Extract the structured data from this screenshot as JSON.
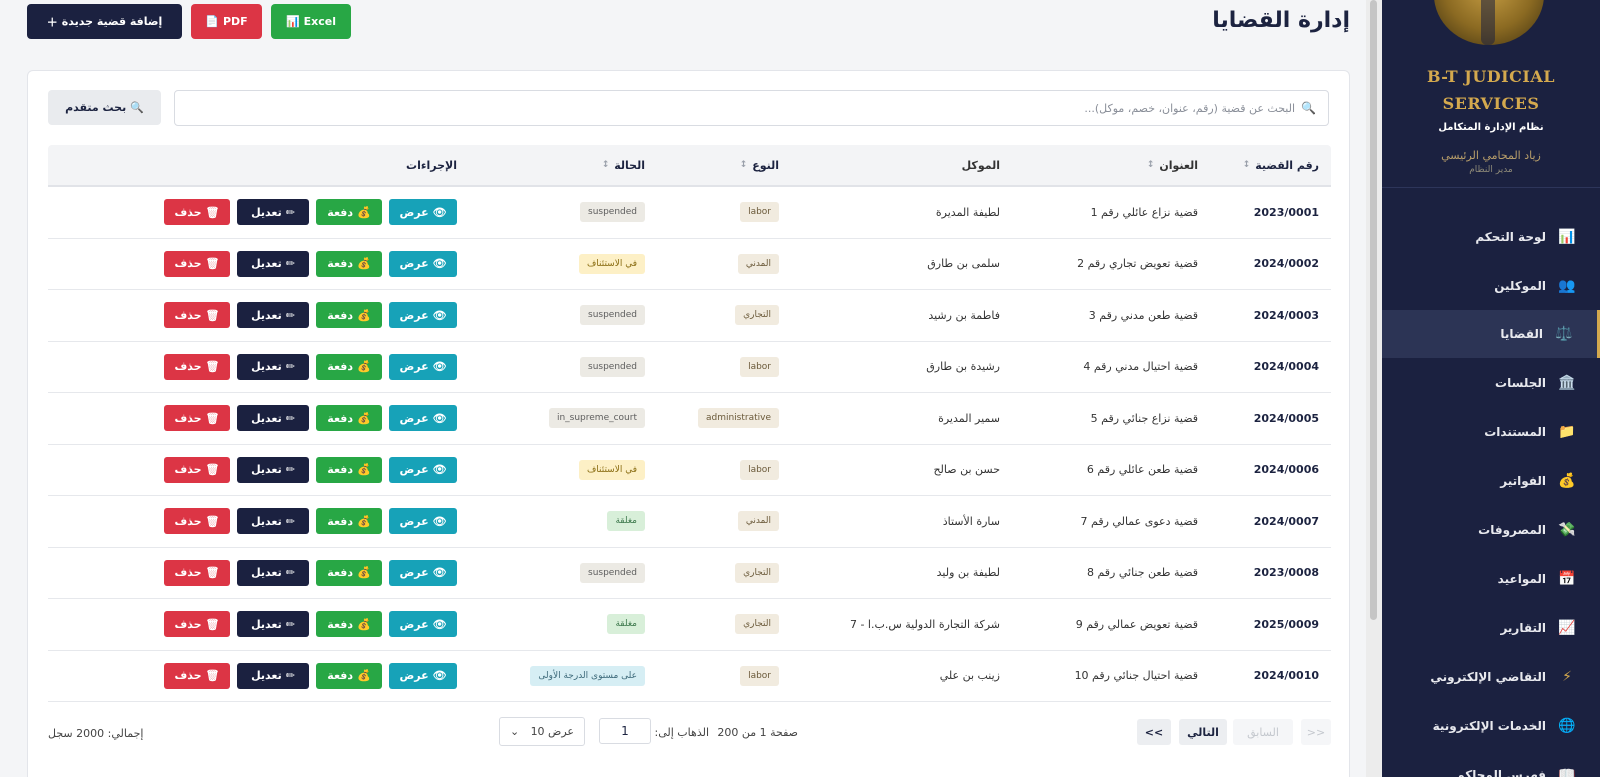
{
  "header": {
    "title": "إدارة القضايا",
    "buttons": {
      "new_case": "إضافة قضية جديدة",
      "pdf": "PDF",
      "excel": "Excel"
    }
  },
  "sidebar": {
    "brand_line1": "B-T JUDICIAL",
    "brand_line2": "SERVICES",
    "subtitle": "نظام الإدارة المتكامل",
    "user_name": "زياد المحامي الرئيسي",
    "user_role": "مدير النظام",
    "items": [
      {
        "label": "لوحة التحكم",
        "icon": "📊"
      },
      {
        "label": "الموكلين",
        "icon": "👥"
      },
      {
        "label": "القضايا",
        "icon": "⚖️",
        "active": true
      },
      {
        "label": "الجلسات",
        "icon": "🏛️"
      },
      {
        "label": "المستندات",
        "icon": "📁"
      },
      {
        "label": "الفواتير",
        "icon": "💰"
      },
      {
        "label": "المصروفات",
        "icon": "💸"
      },
      {
        "label": "المواعيد",
        "icon": "📅"
      },
      {
        "label": "التقارير",
        "icon": "📈"
      },
      {
        "label": "التقاضي الإلكتروني",
        "icon": "⚡"
      },
      {
        "label": "الخدمات الإلكترونية",
        "icon": "🌐"
      },
      {
        "label": "فهرس المحاكم",
        "icon": "📖"
      }
    ]
  },
  "search": {
    "placeholder": "البحث عن قضية (رقم، عنوان، خصم، موكل)...",
    "advanced_label": "بحث متقدم"
  },
  "table": {
    "columns": {
      "number": "رقم القضية",
      "title": "العنوان",
      "client": "الموكل",
      "type": "النوع",
      "status": "الحالة",
      "actions": "الإجراءات"
    },
    "action_labels": {
      "view": "عرض",
      "pay": "دفعة",
      "edit": "تعديل",
      "delete": "حذف"
    },
    "rows": [
      {
        "number": "2023/0001",
        "title": "قضية نزاع عائلي رقم 1",
        "client": "لطيفة المديرة",
        "type": "labor",
        "status": "suspended",
        "status_style": "gray"
      },
      {
        "number": "2024/0002",
        "title": "قضية تعويض تجاري رقم 2",
        "client": "سلمى بن طارق",
        "type": "المدني",
        "status": "في الاستئناف",
        "status_style": "yellow"
      },
      {
        "number": "2024/0003",
        "title": "قضية طعن مدني رقم 3",
        "client": "فاطمة بن رشيد",
        "type": "التجاري",
        "status": "suspended",
        "status_style": "gray"
      },
      {
        "number": "2024/0004",
        "title": "قضية احتيال مدني رقم 4",
        "client": "رشيدة بن طارق",
        "type": "labor",
        "status": "suspended",
        "status_style": "gray"
      },
      {
        "number": "2024/0005",
        "title": "قضية نزاع جنائي رقم 5",
        "client": "سمير المديرة",
        "type": "administrative",
        "status": "in_supreme_court",
        "status_style": "gray"
      },
      {
        "number": "2024/0006",
        "title": "قضية طعن عائلي رقم 6",
        "client": "حسن بن صالح",
        "type": "labor",
        "status": "في الاستئناف",
        "status_style": "yellow"
      },
      {
        "number": "2024/0007",
        "title": "قضية دعوى عمالي رقم 7",
        "client": "سارة الأستاذ",
        "type": "المدني",
        "status": "مغلقة",
        "status_style": "green"
      },
      {
        "number": "2023/0008",
        "title": "قضية طعن جنائي رقم 8",
        "client": "لطيفة بن وليد",
        "type": "التجاري",
        "status": "suspended",
        "status_style": "gray"
      },
      {
        "number": "2025/0009",
        "title": "قضية تعويض عمالي رقم 9",
        "client": "شركة التجارة الدولية س.ب.ا - 7",
        "type": "التجاري",
        "status": "مغلقة",
        "status_style": "green"
      },
      {
        "number": "2024/0010",
        "title": "قضية احتيال جنائي رقم 10",
        "client": "زينب بن علي",
        "type": "labor",
        "status": "على مستوى الدرجة الأولى",
        "status_style": "blue"
      }
    ]
  },
  "pagination": {
    "first": "<<",
    "prev": "السابق",
    "next": "التالي",
    "last": ">>",
    "info": "صفحة 1 من 200",
    "goto_label": "الذهاب إلى:",
    "goto_value": "1",
    "page_size": "عرض 10",
    "total": "إجمالي: 2000 سجل"
  }
}
